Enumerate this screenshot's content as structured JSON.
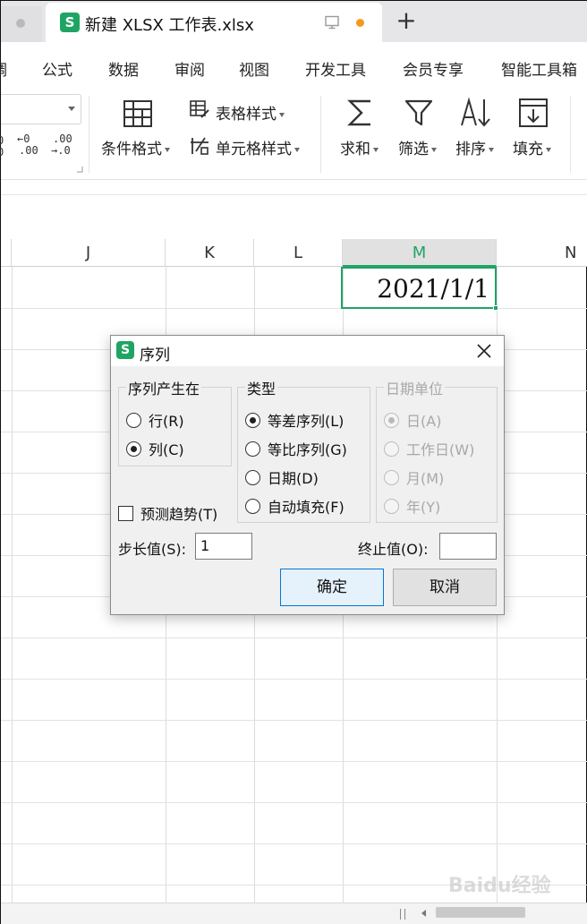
{
  "tabs": {
    "file_title": "新建 XLSX 工作表.xlsx",
    "new_tab": "+",
    "logo_letter": "S"
  },
  "menu": [
    "调",
    "公式",
    "数据",
    "审阅",
    "视图",
    "开发工具",
    "会员专享",
    "智能工具箱"
  ],
  "ribbon": {
    "decimal_increase": [
      "←0",
      ".00"
    ],
    "decimal_decrease": [
      ".00",
      "→.0"
    ],
    "conditional_format": "条件格式",
    "table_style": "表格样式",
    "cell_style": "单元格样式",
    "sum": "求和",
    "filter": "筛选",
    "sort": "排序",
    "fill": "填充"
  },
  "sheet": {
    "columns": [
      "J",
      "K",
      "L",
      "M",
      "N"
    ],
    "active_column": "M",
    "active_cell_value": "2021/1/1"
  },
  "dialog": {
    "title": "序列",
    "group_series_in": {
      "title": "序列产生在",
      "options": [
        {
          "label": "行(R)",
          "checked": false
        },
        {
          "label": "列(C)",
          "checked": true
        }
      ]
    },
    "group_type": {
      "title": "类型",
      "options": [
        {
          "label": "等差序列(L)",
          "checked": true
        },
        {
          "label": "等比序列(G)",
          "checked": false
        },
        {
          "label": "日期(D)",
          "checked": false
        },
        {
          "label": "自动填充(F)",
          "checked": false
        }
      ]
    },
    "group_date_unit": {
      "title": "日期单位",
      "disabled": true,
      "options": [
        {
          "label": "日(A)",
          "checked": true
        },
        {
          "label": "工作日(W)",
          "checked": false
        },
        {
          "label": "月(M)",
          "checked": false
        },
        {
          "label": "年(Y)",
          "checked": false
        }
      ]
    },
    "trend_checkbox": {
      "label": "预测趋势(T)",
      "checked": false
    },
    "step_label": "步长值(S):",
    "step_value": "1",
    "stop_label": "终止值(O):",
    "stop_value": "",
    "ok_button": "确定",
    "cancel_button": "取消"
  },
  "watermark": "Baidu经验",
  "colors": {
    "accent_green": "#21a366",
    "logo_green": "#1fa463",
    "modified_dot": "#f29a1f",
    "primary_button_border": "#0078d7"
  }
}
